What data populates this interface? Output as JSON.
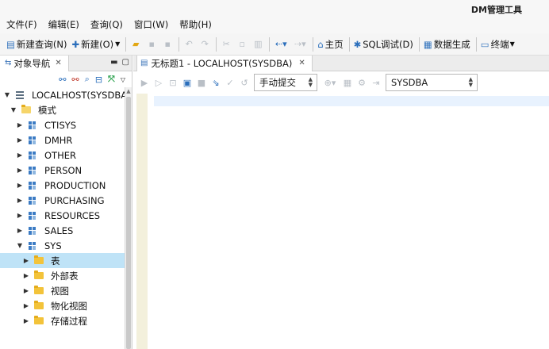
{
  "app": {
    "title": "DM管理工具"
  },
  "menu": [
    "文件(F)",
    "编辑(E)",
    "查询(Q)",
    "窗口(W)",
    "帮助(H)"
  ],
  "toolbar": {
    "new_query": "新建查询(N)",
    "new": "新建(O)",
    "home": "主页",
    "sql_debug": "SQL调试(D)",
    "data_gen": "数据生成",
    "terminal": "终端"
  },
  "navigator": {
    "tab_label": "对象导航",
    "connection": "LOCALHOST(SYSDBA)",
    "schema_group": "模式",
    "schemas": [
      "CTISYS",
      "DMHR",
      "OTHER",
      "PERSON",
      "PRODUCTION",
      "PURCHASING",
      "RESOURCES",
      "SALES",
      "SYS"
    ],
    "sys_children": [
      "表",
      "外部表",
      "视图",
      "物化视图",
      "存储过程"
    ],
    "selected": "表"
  },
  "editor": {
    "tab_label": "无标题1 - LOCALHOST(SYSDBA)",
    "commit_mode": "手动提交",
    "schema": "SYSDBA",
    "content": ""
  }
}
